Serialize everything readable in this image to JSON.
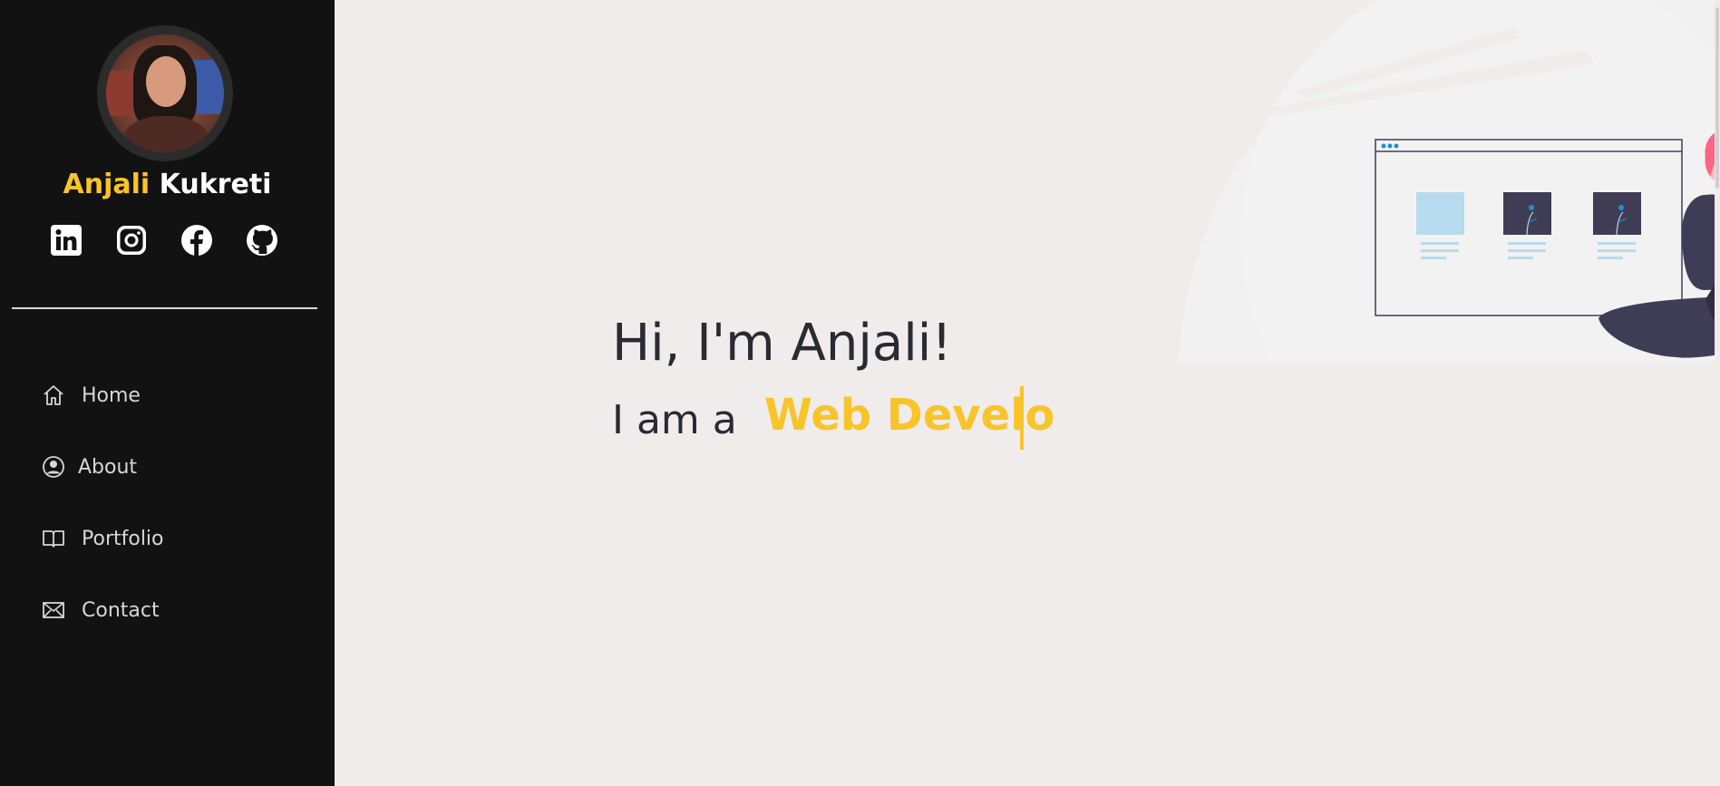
{
  "profile": {
    "first_name": "Anjali",
    "last_name": "Kukreti",
    "avatar_alt": "profile photo"
  },
  "socials": [
    {
      "name": "linkedin",
      "icon": "linkedin-icon"
    },
    {
      "name": "instagram",
      "icon": "instagram-icon"
    },
    {
      "name": "facebook",
      "icon": "facebook-icon"
    },
    {
      "name": "github",
      "icon": "github-icon"
    }
  ],
  "nav": {
    "items": [
      {
        "label": "Home",
        "icon": "home-icon"
      },
      {
        "label": "About",
        "icon": "user-circle-icon"
      },
      {
        "label": "Portfolio",
        "icon": "book-icon"
      },
      {
        "label": "Contact",
        "icon": "envelope-icon"
      }
    ]
  },
  "hero": {
    "title": "Hi, I'm Anjali!",
    "subtitle_prefix": "I am a",
    "typed_text": "Web Develo"
  },
  "colors": {
    "sidebar_bg": "#121212",
    "accent": "#f8c42a",
    "main_bg": "#efeceb",
    "text_dark": "#2a2a33"
  }
}
